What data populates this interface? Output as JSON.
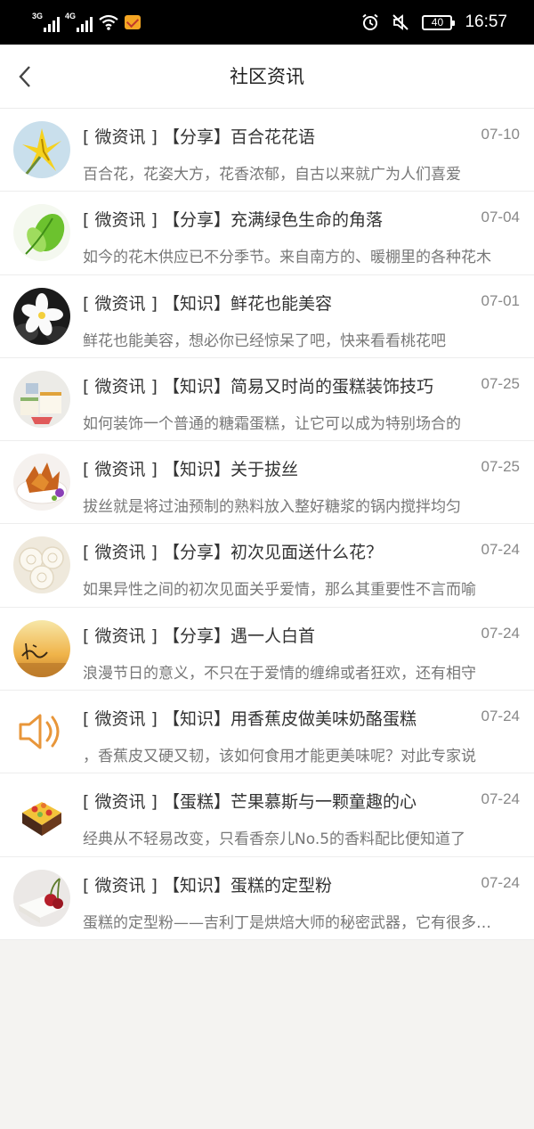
{
  "status_bar": {
    "net1": "3G",
    "net2": "4G",
    "battery": "40",
    "time": "16:57"
  },
  "header": {
    "title": "社区资讯"
  },
  "news": [
    {
      "tag": "[ 微资讯 ]",
      "category": "【分享】",
      "title": "百合花花语",
      "date": "07-10",
      "summary": "百合花，花姿大方，花香浓郁，自古以来就广为人们喜爱",
      "thumb_icon": "lily-photo"
    },
    {
      "tag": "[ 微资讯 ]",
      "category": "【分享】",
      "title": "充满绿色生命的角落",
      "date": "07-04",
      "summary": "如今的花木供应已不分季节。来自南方的、暖棚里的各种花木",
      "thumb_icon": "green-plant-photo"
    },
    {
      "tag": "[ 微资讯 ]",
      "category": "【知识】",
      "title": "鲜花也能美容",
      "date": "07-01",
      "summary": "鲜花也能美容，想必你已经惊呆了吧，快来看看桃花吧",
      "thumb_icon": "white-flower-photo"
    },
    {
      "tag": "[ 微资讯 ]",
      "category": "【知识】",
      "title": "简易又时尚的蛋糕装饰技巧",
      "date": "07-25",
      "summary": "如何装饰一个普通的糖霜蛋糕，让它可以成为特别场合的",
      "thumb_icon": "cake-slices-photo"
    },
    {
      "tag": "[ 微资讯 ]",
      "category": "【知识】",
      "title": "关于拔丝",
      "date": "07-25",
      "summary": "拔丝就是将过油预制的熟料放入整好糖浆的锅内搅拌均匀",
      "thumb_icon": "fried-dish-photo"
    },
    {
      "tag": "[ 微资讯 ]",
      "category": "【分享】",
      "title": "初次见面送什么花？",
      "date": "07-24",
      "summary": "如果异性之间的初次见面关乎爱情，那么其重要性不言而喻",
      "thumb_icon": "white-roses-photo"
    },
    {
      "tag": "[ 微资讯 ]",
      "category": "【分享】",
      "title": "遇一人白首",
      "date": "07-24",
      "summary": "浪漫节日的意义，不只在于爱情的缠绵或者狂欢，还有相守",
      "thumb_icon": "sunset-calligraphy-photo"
    },
    {
      "tag": "[ 微资讯 ]",
      "category": "【知识】",
      "title": "用香蕉皮做美味奶酪蛋糕",
      "date": "07-24",
      "summary": "，香蕉皮又硬又韧，该如何食用才能更美味呢？对此专家说",
      "thumb_icon": "speaker-icon"
    },
    {
      "tag": "[ 微资讯 ]",
      "category": "【蛋糕】",
      "title": "芒果慕斯与一颗童趣的心",
      "date": "07-24",
      "summary": "经典从不轻易改变，只看香奈儿No.5的香料配比便知道了",
      "thumb_icon": "mousse-cake-photo"
    },
    {
      "tag": "[ 微资讯 ]",
      "category": "【知识】",
      "title": "蛋糕的定型粉",
      "date": "07-24",
      "summary": "蛋糕的定型粉——吉利丁是烘焙大师的秘密武器，它有很多用处",
      "thumb_icon": "cherry-dessert-photo"
    }
  ]
}
